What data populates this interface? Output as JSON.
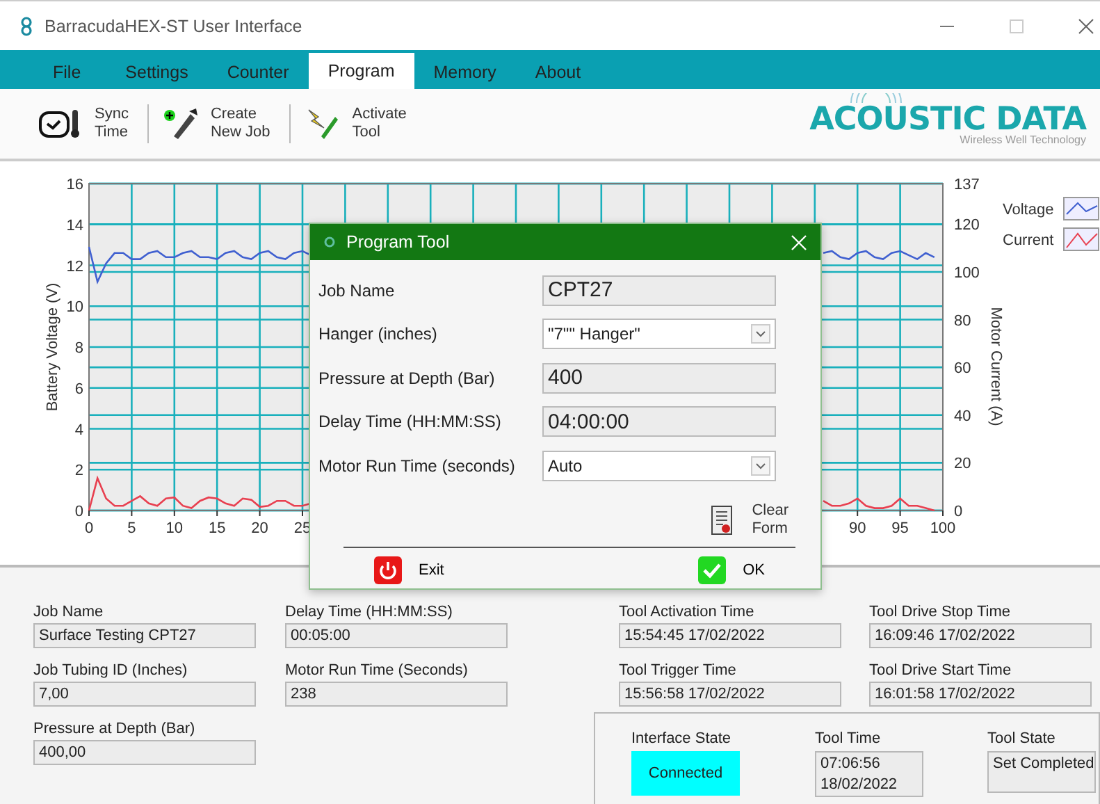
{
  "window": {
    "title": "BarracudaHEX-ST User Interface"
  },
  "tabs": [
    {
      "label": "File",
      "selected": false
    },
    {
      "label": "Settings",
      "selected": false
    },
    {
      "label": "Counter",
      "selected": false
    },
    {
      "label": "Program",
      "selected": true
    },
    {
      "label": "Memory",
      "selected": false
    },
    {
      "label": "About",
      "selected": false
    }
  ],
  "toolbar": [
    {
      "kind": "sync",
      "lines": [
        "Sync",
        "Time"
      ]
    },
    {
      "kind": "job",
      "lines": [
        "Create",
        "New Job"
      ]
    },
    {
      "kind": "activate",
      "lines": [
        "Activate",
        "Tool"
      ]
    }
  ],
  "logo": {
    "name": "ACOUSTIC DATA",
    "tagline": "Wireless Well Technology"
  },
  "chart": {
    "chart_data": {
      "type": "line",
      "ylabel": "Battery Voltage (V)",
      "y2label": "Motor Current (A)",
      "grid": true,
      "legend": "right",
      "xlim": [
        0,
        100
      ],
      "ylim": [
        0,
        16
      ],
      "y2lim": [
        0,
        137
      ],
      "xticks": [
        0,
        5,
        10,
        15,
        20,
        25,
        90,
        95,
        100
      ],
      "yticks": [
        0,
        2,
        4,
        6,
        8,
        10,
        12,
        14,
        16
      ],
      "y2ticks": [
        0,
        20,
        40,
        60,
        80,
        100,
        120,
        137
      ],
      "x": [
        0,
        1,
        2,
        3,
        4,
        5,
        6,
        7,
        8,
        9,
        10,
        11,
        12,
        13,
        14,
        15,
        16,
        17,
        18,
        19,
        20,
        21,
        22,
        23,
        24,
        25,
        26,
        86,
        87,
        88,
        89,
        90,
        91,
        92,
        93,
        94,
        95,
        96,
        97,
        98,
        99
      ],
      "series": [
        {
          "name": "Voltage",
          "color": "#4060d0",
          "values": [
            12.9,
            11.2,
            12.1,
            12.6,
            12.6,
            12.3,
            12.3,
            12.6,
            12.7,
            12.4,
            12.4,
            12.6,
            12.7,
            12.4,
            12.4,
            12.3,
            12.6,
            12.7,
            12.4,
            12.3,
            12.6,
            12.7,
            12.4,
            12.3,
            12.6,
            12.7,
            12.5,
            12.6,
            12.7,
            12.4,
            12.3,
            12.6,
            12.7,
            12.4,
            12.3,
            12.6,
            12.7,
            12.5,
            12.3,
            12.6,
            12.4
          ]
        },
        {
          "name": "Current",
          "color": "#e84050",
          "axis": "y2",
          "values": [
            0,
            13.5,
            5,
            2,
            2,
            4,
            6,
            3,
            2,
            5,
            5.5,
            2,
            1,
            4,
            5.5,
            5,
            3,
            2,
            5,
            4.5,
            1.5,
            2,
            4,
            4,
            2,
            2,
            3,
            4,
            2,
            2,
            3,
            5,
            2,
            1,
            1,
            2,
            5,
            2,
            2,
            1,
            0
          ]
        }
      ]
    }
  },
  "dialog": {
    "title": "Program Tool",
    "fields": [
      {
        "label": "Job Name",
        "kind": "text",
        "value": "CPT27"
      },
      {
        "label": "Hanger (inches)",
        "kind": "dropdown",
        "value": "\"7\"\" Hanger\""
      },
      {
        "label": "Pressure at Depth (Bar)",
        "kind": "text",
        "value": "400"
      },
      {
        "label": "Delay Time (HH:MM:SS)",
        "kind": "text",
        "value": "04:00:00"
      },
      {
        "label": "Motor Run Time (seconds)",
        "kind": "dropdown",
        "value": "Auto"
      }
    ],
    "clear_button": [
      "Clear",
      "Form"
    ],
    "exit_button": "Exit",
    "ok_button": "OK"
  },
  "left_fields": [
    {
      "label": "Job Name",
      "value": "Surface Testing CPT27"
    },
    {
      "label": "Delay Time (HH:MM:SS)",
      "value": "00:05:00"
    },
    {
      "label": "Job Tubing ID (Inches)",
      "value": "7,00"
    },
    {
      "label": "Motor Run Time (Seconds)",
      "value": "238"
    },
    {
      "label": "Pressure at Depth (Bar)",
      "value": "400,00"
    }
  ],
  "right_fields": [
    {
      "label": "Tool Activation Time",
      "value": "15:54:45 17/02/2022"
    },
    {
      "label": "Tool Drive Stop Time",
      "value": "16:09:46 17/02/2022"
    },
    {
      "label": "Tool Trigger Time",
      "value": "15:56:58 17/02/2022"
    },
    {
      "label": "Tool Drive Start Time",
      "value": "16:01:58 17/02/2022"
    }
  ],
  "status": {
    "interface_state": {
      "label": "Interface State",
      "value": "Connected",
      "color": "#00ffff"
    },
    "tool_time": {
      "label": "Tool Time",
      "lines": [
        "07:06:56",
        "18/02/2022"
      ]
    },
    "tool_state": {
      "label": "Tool State",
      "value": "Set Completed"
    }
  }
}
